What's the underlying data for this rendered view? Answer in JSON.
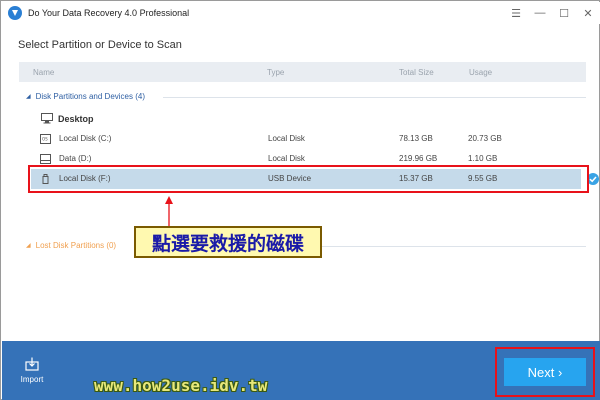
{
  "window": {
    "title": "Do Your Data Recovery 4.0 Professional",
    "controls": [
      "☰",
      "—",
      "☐",
      "✕"
    ]
  },
  "page": {
    "heading": "Select Partition or Device to Scan"
  },
  "table": {
    "columns": [
      "Name",
      "Type",
      "Total Size",
      "Usage"
    ]
  },
  "groups": {
    "disk": {
      "label": "Disk Partitions and Devices (4)"
    },
    "lost": {
      "label": "Lost Disk Partitions (0)"
    }
  },
  "desktop": {
    "label": "Desktop"
  },
  "rows": [
    {
      "name": "Local Disk (C:)",
      "type": "Local Disk",
      "total": "78.13 GB",
      "usage": "20.73 GB",
      "icon": "os-drive-icon"
    },
    {
      "name": "Data (D:)",
      "type": "Local Disk",
      "total": "219.96 GB",
      "usage": "1.10 GB",
      "icon": "hard-drive-icon"
    },
    {
      "name": "Local Disk (F:)",
      "type": "USB Device",
      "total": "15.37 GB",
      "usage": "9.55 GB",
      "icon": "usb-drive-icon",
      "selected": true
    }
  ],
  "annotation": {
    "text": "點選要救援的磁碟"
  },
  "bottom": {
    "import_label": "Import",
    "next_label": "Next ›"
  },
  "watermark": "www.how2use.idv.tw",
  "colors": {
    "accent": "#27a4ef",
    "bottom_bar": "#3572b8",
    "selected_row": "#c5daea",
    "highlight_red": "#e8121a",
    "group_blue": "#2e5fa3",
    "group_orange": "#f0a050"
  }
}
